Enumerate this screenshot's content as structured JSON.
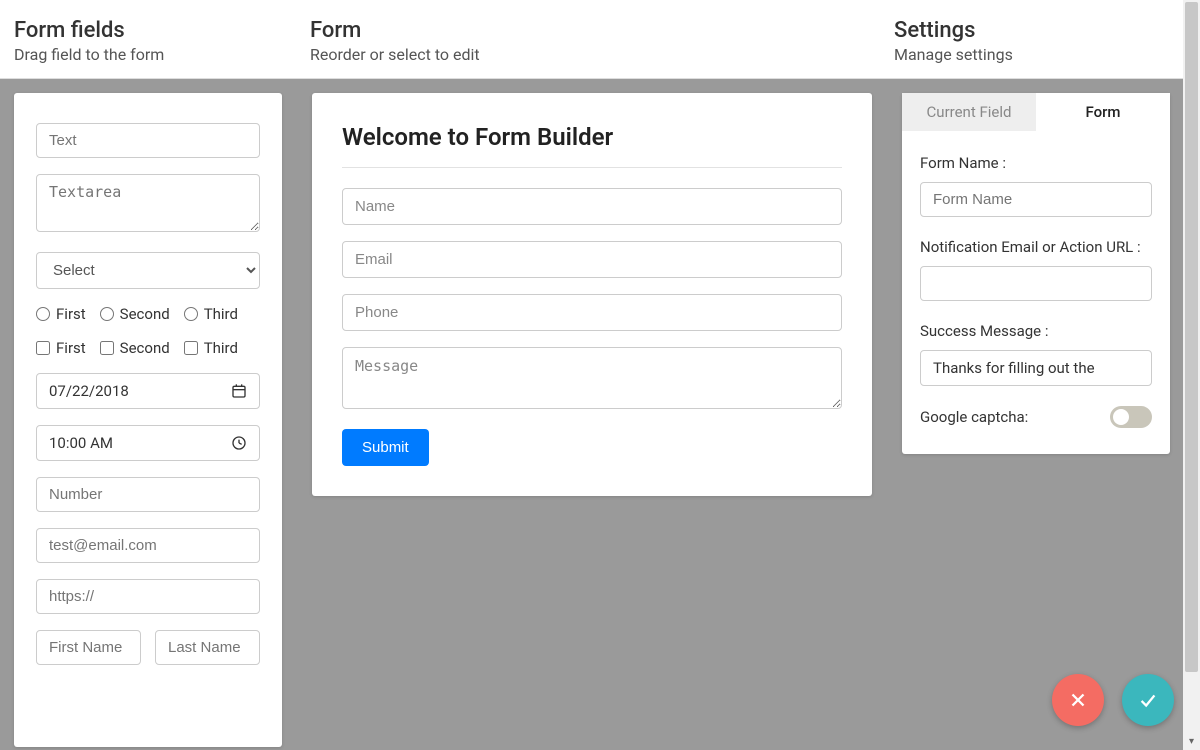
{
  "header": {
    "fields": {
      "title": "Form fields",
      "sub": "Drag field to the form"
    },
    "form": {
      "title": "Form",
      "sub": "Reorder or select to edit"
    },
    "settings": {
      "title": "Settings",
      "sub": "Manage settings"
    }
  },
  "palette": {
    "text_placeholder": "Text",
    "textarea_placeholder": "Textarea",
    "select_placeholder": "Select",
    "radio_options": [
      "First",
      "Second",
      "Third"
    ],
    "check_options": [
      "First",
      "Second",
      "Third"
    ],
    "date_value": "07/22/2018",
    "time_value": "10:00 AM",
    "number_placeholder": "Number",
    "email_placeholder": "test@email.com",
    "url_placeholder": "https://",
    "first_name_placeholder": "First Name",
    "last_name_placeholder": "Last Name"
  },
  "canvas": {
    "title": "Welcome to Form Builder",
    "fields": {
      "name": "Name",
      "email": "Email",
      "phone": "Phone",
      "message": "Message"
    },
    "submit_label": "Submit"
  },
  "settings": {
    "tab_current": "Current Field",
    "tab_form": "Form",
    "form_name_label": "Form Name :",
    "form_name_placeholder": "Form Name",
    "notification_label": "Notification Email or Action URL :",
    "success_label": "Success Message :",
    "success_value": "Thanks for filling out the",
    "captcha_label": "Google captcha:"
  }
}
